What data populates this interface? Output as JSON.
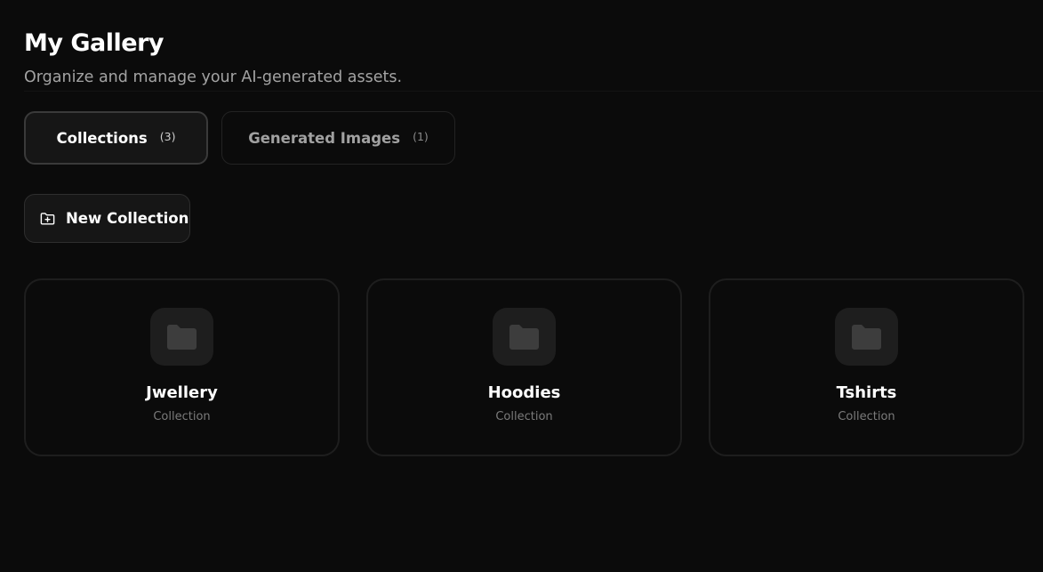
{
  "header": {
    "title": "My Gallery",
    "subtitle": "Organize and manage your AI-generated assets."
  },
  "tabs": [
    {
      "label": "Collections",
      "count": "(3)",
      "active": true
    },
    {
      "label": "Generated Images",
      "count": "(1)",
      "active": false
    }
  ],
  "toolbar": {
    "new_collection_label": "New Collection",
    "new_collection_icon": "folder-plus-icon"
  },
  "collections": [
    {
      "name": "Jwellery",
      "type": "Collection",
      "icon": "folder-icon"
    },
    {
      "name": "Hoodies",
      "type": "Collection",
      "icon": "folder-icon"
    },
    {
      "name": "Tshirts",
      "type": "Collection",
      "icon": "folder-icon"
    }
  ],
  "colors": {
    "background": "#0b0b0b",
    "card_border": "#1e1e1e",
    "active_tab_border": "#3a3a3a",
    "folder_icon": "#3d3d3d",
    "muted_text": "#7b7b7b"
  }
}
